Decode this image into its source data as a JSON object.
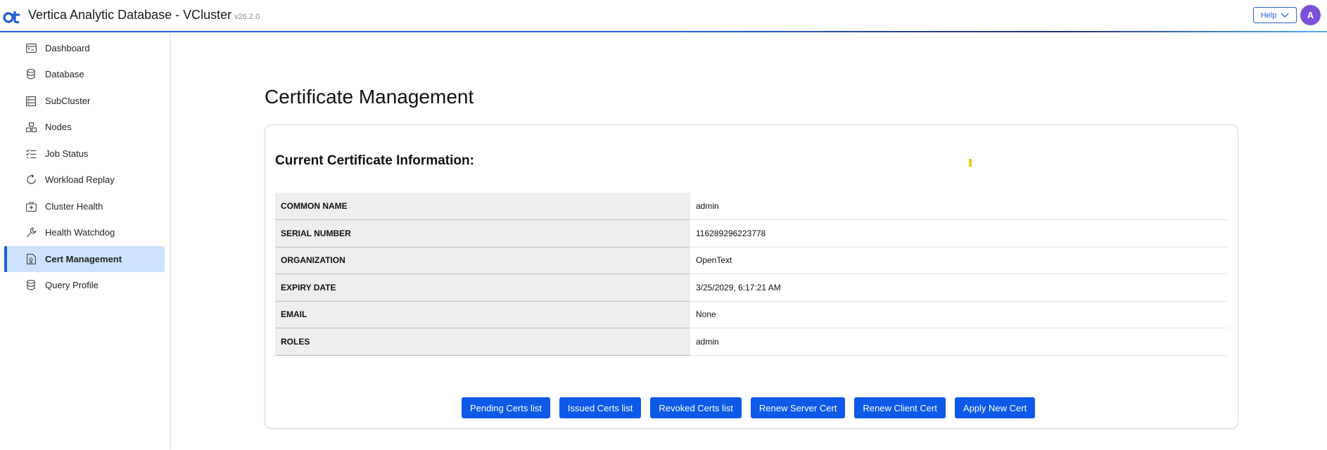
{
  "header": {
    "title": "Vertica Analytic Database - VCluster",
    "version": "v26.2.0",
    "help_label": "Help",
    "avatar_initial": "A",
    "colors": {
      "accent": "#2b62d9",
      "avatar": "#7b4fd6"
    }
  },
  "sidebar": {
    "items": [
      {
        "label": "Dashboard",
        "icon": "dashboard-icon"
      },
      {
        "label": "Database",
        "icon": "database-icon"
      },
      {
        "label": "SubCluster",
        "icon": "subcluster-icon"
      },
      {
        "label": "Nodes",
        "icon": "nodes-icon"
      },
      {
        "label": "Job Status",
        "icon": "job-status-icon"
      },
      {
        "label": "Workload Replay",
        "icon": "replay-icon"
      },
      {
        "label": "Cluster Health",
        "icon": "cluster-health-icon"
      },
      {
        "label": "Health Watchdog",
        "icon": "wrench-icon"
      },
      {
        "label": "Cert Management",
        "icon": "certificate-icon",
        "active": true
      },
      {
        "label": "Query Profile",
        "icon": "query-profile-icon"
      }
    ]
  },
  "main": {
    "title": "Certificate Management",
    "card_title": "Current Certificate Information:",
    "rows": [
      {
        "key": "COMMON NAME",
        "value": "admin"
      },
      {
        "key": "SERIAL NUMBER",
        "value": "116289296223778"
      },
      {
        "key": "ORGANIZATION",
        "value": "OpenText"
      },
      {
        "key": "EXPIRY DATE",
        "value": "3/25/2029, 6:17:21 AM"
      },
      {
        "key": "EMAIL",
        "value": "None"
      },
      {
        "key": "ROLES",
        "value": "admin"
      }
    ],
    "buttons": [
      "Pending Certs list",
      "Issued Certs list",
      "Revoked Certs list",
      "Renew Server Cert",
      "Renew Client Cert",
      "Apply New Cert"
    ]
  }
}
